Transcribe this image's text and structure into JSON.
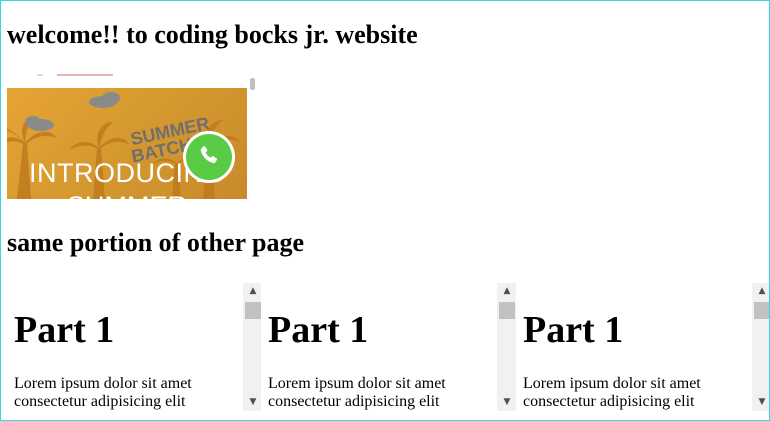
{
  "page": {
    "heading": "welcome!! to coding bocks jr. website",
    "subheading": "same portion of other page"
  },
  "banner": {
    "title_line1": "INTRODUCING",
    "title_line2": "SUMMER",
    "stamp_line1": "SUMMER",
    "stamp_line2": "BATCHES",
    "whatsapp_icon": "whatsapp-icon"
  },
  "panes": [
    {
      "title": "Part 1",
      "text_line1": "Lorem ipsum dolor sit amet",
      "text_line2": "consectetur adipisicing elit"
    },
    {
      "title": "Part 1",
      "text_line1": "Lorem ipsum dolor sit amet",
      "text_line2": "consectetur adipisicing elit"
    },
    {
      "title": "Part 1",
      "text_line1": "Lorem ipsum dolor sit amet",
      "text_line2": "consectetur adipisicing elit"
    }
  ],
  "scrollbar": {
    "up_arrow": "▲",
    "down_arrow": "▼"
  },
  "colors": {
    "page_border": "#38d6e0",
    "banner_orange": "#e7a335",
    "whatsapp_green": "#5acb45"
  }
}
